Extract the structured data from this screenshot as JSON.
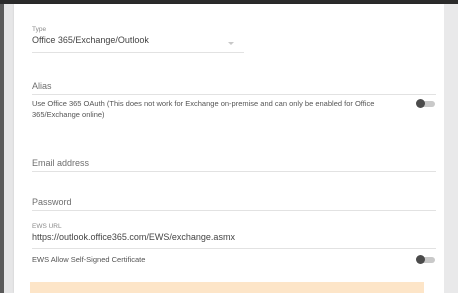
{
  "form": {
    "type": {
      "label": "Type",
      "value": "Office 365/Exchange/Outlook"
    },
    "alias": {
      "placeholder": "Alias"
    },
    "oauth_toggle": {
      "label": "Use Office 365 OAuth (This does not work for Exchange on-premise and can only be enabled for Office 365/Exchange online)",
      "enabled": false
    },
    "email": {
      "placeholder": "Email address"
    },
    "password": {
      "placeholder": "Password"
    },
    "ews_url": {
      "label": "EWS URL",
      "value": "https://outlook.office365.com/EWS/exchange.asmx"
    },
    "self_signed_toggle": {
      "label": "EWS Allow Self-Signed Certificate",
      "enabled": false
    }
  },
  "colors": {
    "toggle_thumb": "#4b4b4b",
    "toggle_track": "#c9c9c9",
    "warning_background": "#fde5c8"
  }
}
